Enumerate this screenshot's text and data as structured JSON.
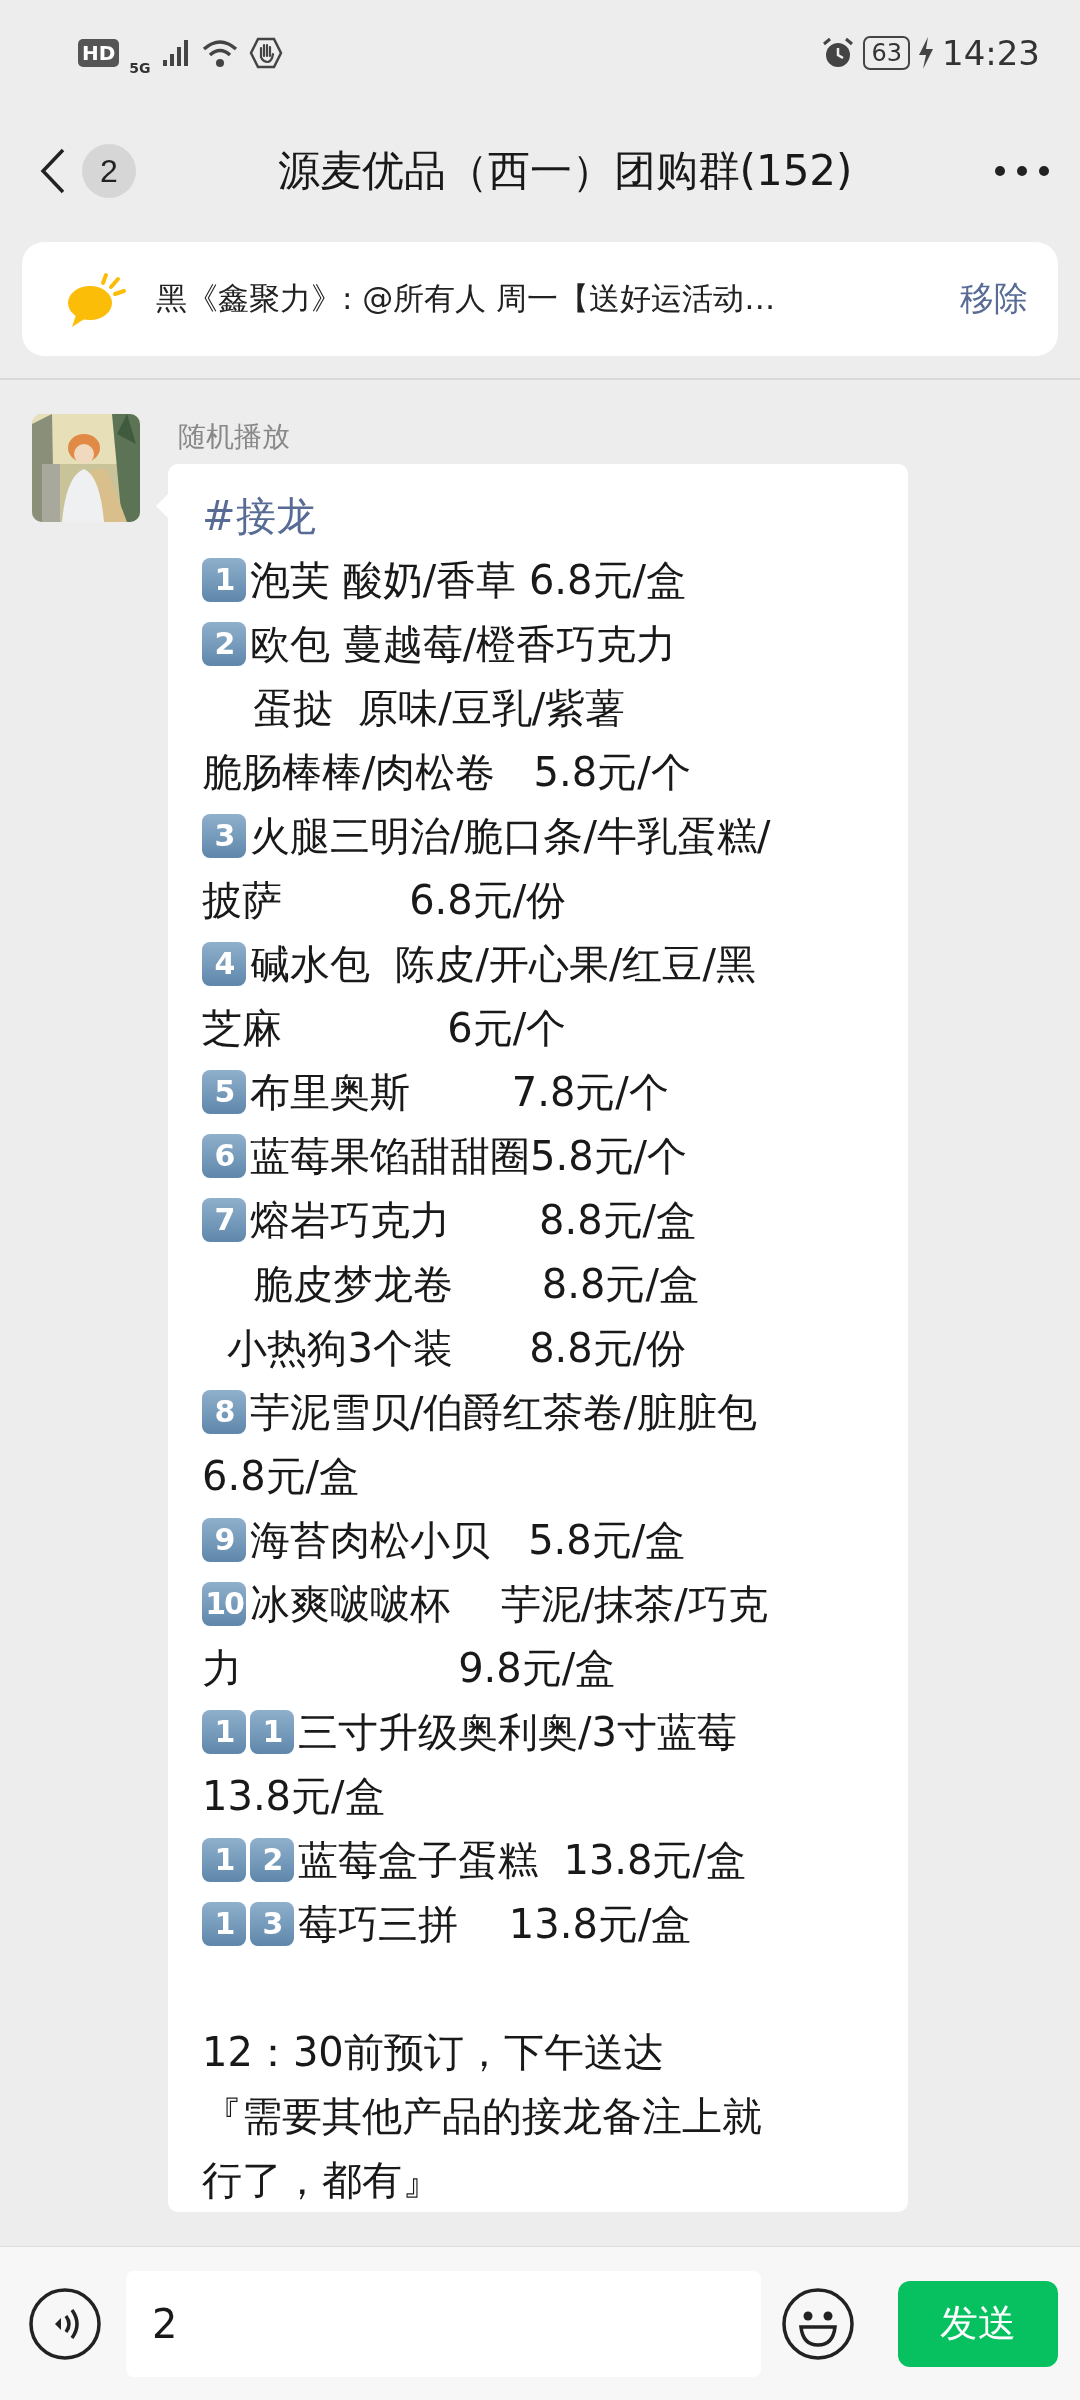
{
  "status_bar": {
    "hd_label": "HD",
    "network_label": "5G",
    "battery": "63",
    "time": "14:23"
  },
  "header": {
    "back_badge": "2",
    "title": "源麦优品（西一）团购群(152)"
  },
  "pinned": {
    "text": "黑《鑫聚力》: @所有人   周一【送好运活动…",
    "action": "移除"
  },
  "messages": [
    {
      "sender": "随机播放",
      "lines": [
        {
          "kind": "tag",
          "text": "#接龙"
        },
        {
          "kind": "text",
          "keycaps": [
            "1"
          ],
          "text": "泡芙 酸奶/香草 6.8元/盒"
        },
        {
          "kind": "text",
          "keycaps": [
            "2"
          ],
          "text": "欧包 蔓越莓/橙香巧克力"
        },
        {
          "kind": "text",
          "text": "    蛋挞  原味/豆乳/紫薯"
        },
        {
          "kind": "text",
          "text": "脆肠棒棒/肉松卷   5.8元/个"
        },
        {
          "kind": "text",
          "keycaps": [
            "3"
          ],
          "text": "火腿三明治/脆口条/牛乳蛋糕/"
        },
        {
          "kind": "text",
          "text": "披萨          6.8元/份"
        },
        {
          "kind": "text",
          "keycaps": [
            "4"
          ],
          "text": "碱水包  陈皮/开心果/红豆/黑"
        },
        {
          "kind": "text",
          "text": "芝麻             6元/个"
        },
        {
          "kind": "text",
          "keycaps": [
            "5"
          ],
          "text": "布里奥斯        7.8元/个"
        },
        {
          "kind": "text",
          "keycaps": [
            "6"
          ],
          "text": "蓝莓果馅甜甜圈5.8元/个"
        },
        {
          "kind": "text",
          "keycaps": [
            "7"
          ],
          "text": "熔岩巧克力       8.8元/盒"
        },
        {
          "kind": "text",
          "text": "    脆皮梦龙卷       8.8元/盒"
        },
        {
          "kind": "text",
          "text": "  小热狗3个装      8.8元/份"
        },
        {
          "kind": "text",
          "keycaps": [
            "8"
          ],
          "text": "芋泥雪贝/伯爵红茶卷/脏脏包"
        },
        {
          "kind": "text",
          "text": "6.8元/盒"
        },
        {
          "kind": "text",
          "keycaps": [
            "9"
          ],
          "text": "海苔肉松小贝   5.8元/盒"
        },
        {
          "kind": "text",
          "keycaps": [
            "10"
          ],
          "text": "冰爽啵啵杯    芋泥/抹茶/巧克"
        },
        {
          "kind": "text",
          "text": "力                 9.8元/盒"
        },
        {
          "kind": "text",
          "keycaps": [
            "1",
            "1"
          ],
          "text": "三寸升级奥利奥/3寸蓝莓"
        },
        {
          "kind": "text",
          "text": "13.8元/盒"
        },
        {
          "kind": "text",
          "keycaps": [
            "1",
            "2"
          ],
          "text": "蓝莓盒子蛋糕  13.8元/盒"
        },
        {
          "kind": "text",
          "keycaps": [
            "1",
            "3"
          ],
          "text": "莓巧三拼    13.8元/盒"
        },
        {
          "kind": "blank"
        },
        {
          "kind": "text",
          "text": "12：30前预订，下午送达"
        },
        {
          "kind": "text",
          "text": "『需要其他产品的接龙备注上就"
        },
        {
          "kind": "text",
          "text": "行了，都有』"
        }
      ]
    }
  ],
  "composer": {
    "value": "2",
    "send": "发送"
  }
}
